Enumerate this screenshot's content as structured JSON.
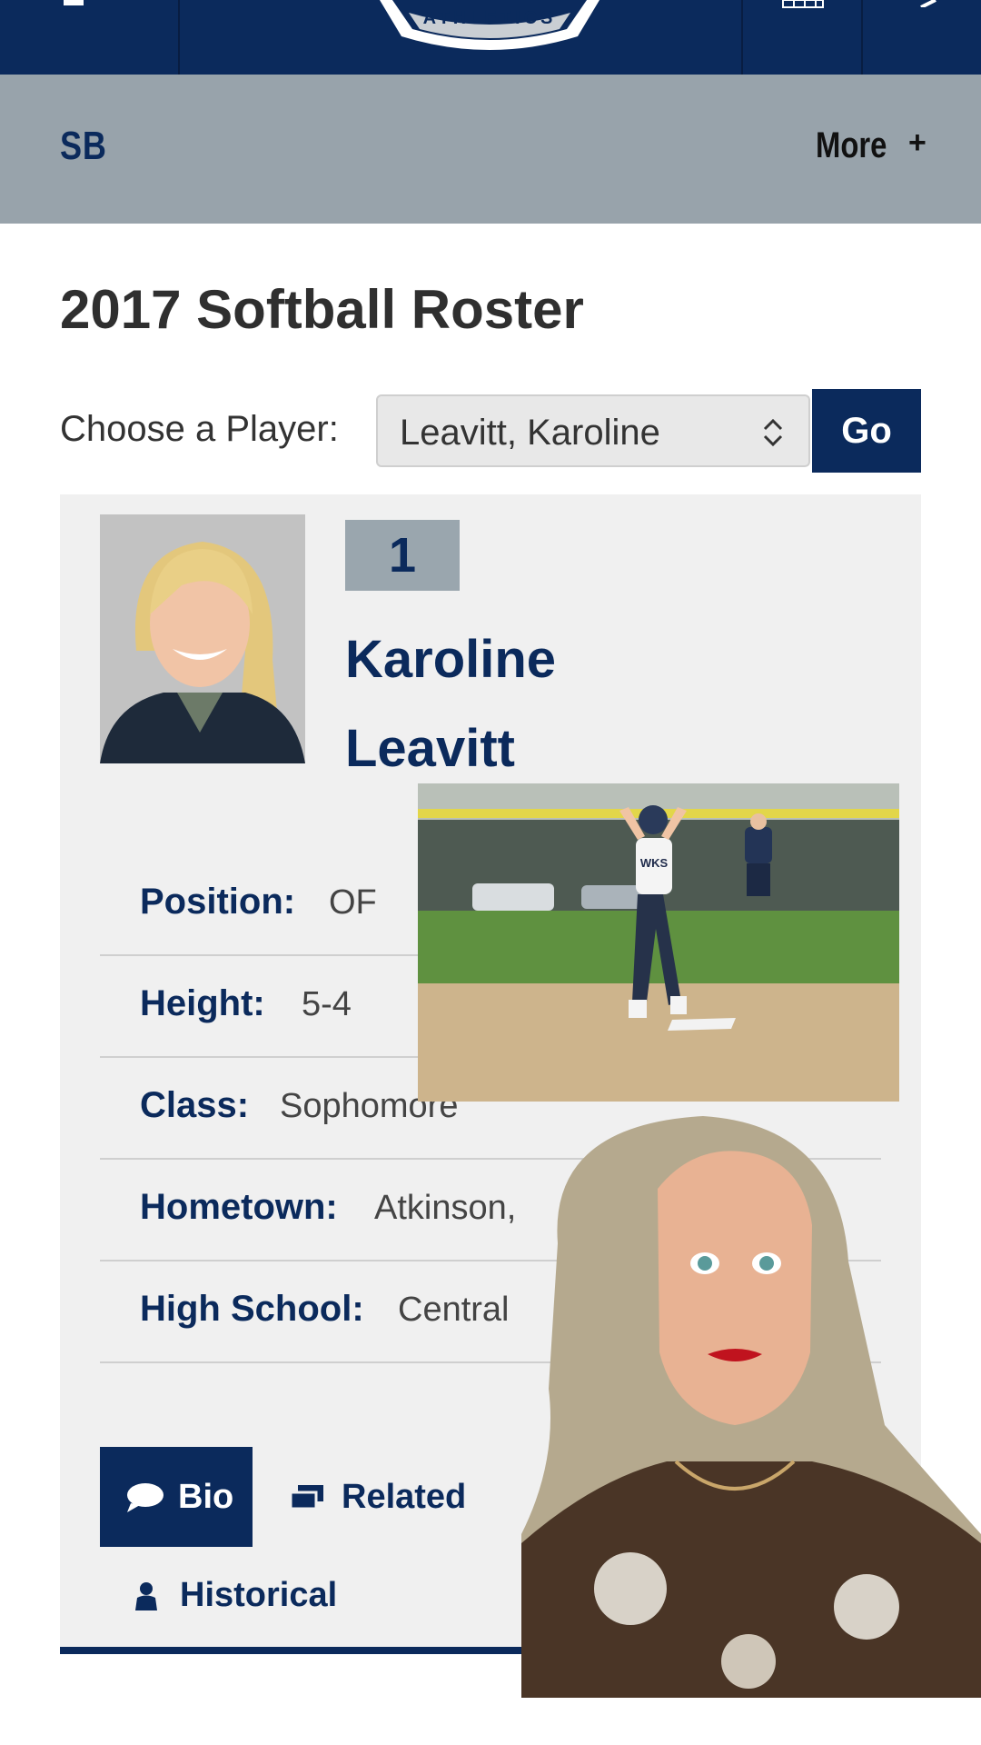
{
  "brand": {
    "logo_text": "ATHLETICS",
    "navy": "#0b2a5c",
    "subnav_gray": "#98a3ab"
  },
  "topbar": {
    "menu_icon": "menu-icon",
    "schedule_icon": "calendar-icon",
    "search_icon": "search-icon"
  },
  "subnav": {
    "sport": "SB",
    "more_label": "More",
    "more_icon": "+"
  },
  "page": {
    "title": "2017 Softball Roster"
  },
  "chooser": {
    "label": "Choose a Player:",
    "selected": "Leavitt, Karoline",
    "go_label": "Go"
  },
  "player": {
    "number": "1",
    "first_name": "Karoline",
    "last_name": "Leavitt",
    "fields": [
      {
        "label": "Position:",
        "value": "OF"
      },
      {
        "label": "Height:",
        "value": "5-4"
      },
      {
        "label": "Class:",
        "value": "Sophomore"
      },
      {
        "label": "Hometown:",
        "value": "Atkinson,"
      },
      {
        "label": "High School:",
        "value": "Central"
      }
    ]
  },
  "tabs": {
    "bio": "Bio",
    "related": "Related",
    "historical": "Historical"
  },
  "overlays": {
    "jersey_text": "WKS"
  }
}
